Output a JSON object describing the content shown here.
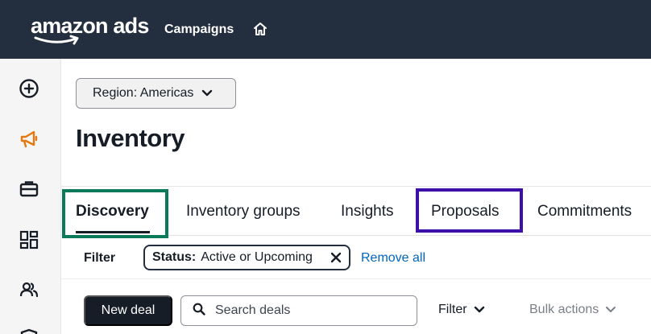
{
  "header": {
    "logo": "amazon ads",
    "nav_campaigns": "Campaigns",
    "home_icon": "home-icon",
    "background": "#232f3e"
  },
  "sidebar": {
    "icons": [
      "plus-circle-icon",
      "megaphone-icon",
      "briefcase-icon",
      "dashboard-icon",
      "users-icon",
      "shield-icon"
    ],
    "active_color": "#e47911"
  },
  "main": {
    "region": {
      "label": "Region: Americas"
    },
    "page_title": "Inventory",
    "tabs": [
      {
        "label": "Discovery",
        "active": true
      },
      {
        "label": "Inventory groups",
        "active": false
      },
      {
        "label": "Insights",
        "active": false
      },
      {
        "label": "Proposals",
        "active": false
      },
      {
        "label": "Commitments",
        "active": false
      }
    ],
    "filter": {
      "label": "Filter",
      "chip_key": "Status:",
      "chip_value": "Active or Upcoming",
      "remove_all": "Remove all"
    },
    "toolbar": {
      "new_deal": "New deal",
      "search_placeholder": "Search deals",
      "filter": "Filter",
      "bulk_actions": "Bulk actions"
    },
    "highlights": {
      "green": "#0a7a5a",
      "purple": "#3b0fa8"
    }
  }
}
